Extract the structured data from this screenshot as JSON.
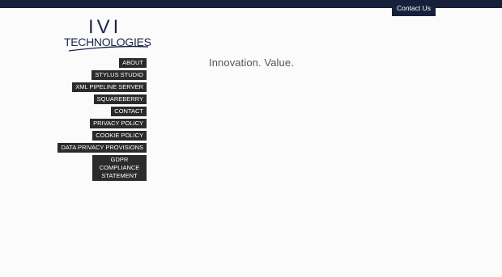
{
  "header": {
    "contact_label": "Contact Us"
  },
  "logo": {
    "line1": "IVI",
    "line2": "TECHNOLOGIES"
  },
  "tagline": "Innovation. Value.",
  "nav": {
    "items": [
      {
        "label": "ABOUT"
      },
      {
        "label": "STYLUS STUDIO"
      },
      {
        "label": "XML PIPELINE SERVER"
      },
      {
        "label": "SQUAREBERRY"
      },
      {
        "label": "CONTACT"
      },
      {
        "label": "PRIVACY POLICY"
      },
      {
        "label": "COOKIE POLICY"
      },
      {
        "label": "DATA PRIVACY PROVISIONS"
      },
      {
        "label": "GDPR COMPLIANCE STATEMENT"
      }
    ]
  },
  "colors": {
    "brand_navy": "#17203a",
    "nav_bg": "#2b2b2b",
    "page_bg": "#fbfbfb"
  }
}
